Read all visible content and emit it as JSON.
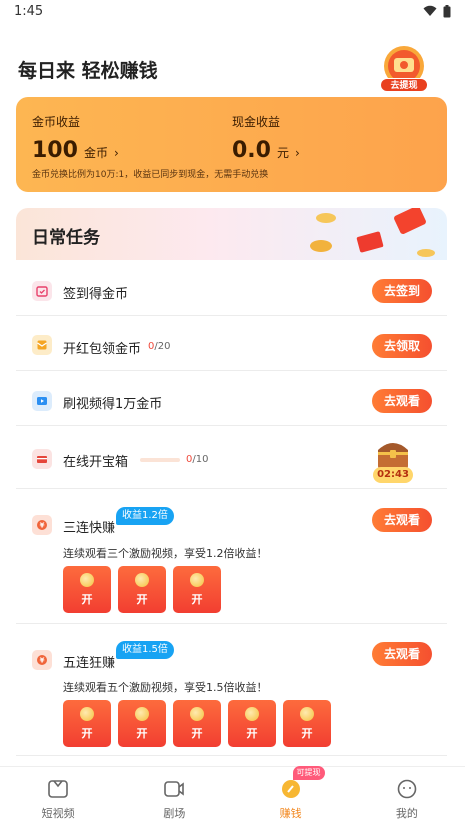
{
  "status_bar": {
    "time": "1:45"
  },
  "header": {
    "title": "每日来 轻松赚钱",
    "rank_label": "去提现"
  },
  "earnings": {
    "coin_title": "金币收益",
    "coin_value": "100",
    "coin_unit": "金币",
    "cash_title": "现金收益",
    "cash_value": "0.0",
    "cash_unit": "元",
    "note": "金币兑换比例为10万:1，收益已同步到现金，无需手动兑换"
  },
  "daily": {
    "title": "日常任务",
    "tasks": [
      {
        "name": "签到得金币",
        "button": "去签到"
      },
      {
        "name": "开红包领金币",
        "progress_current": "0",
        "progress_total": "/20",
        "button": "去领取"
      },
      {
        "name": "刷视频得1万金币",
        "button": "去观看"
      },
      {
        "name": "在线开宝箱",
        "progress_current": "0",
        "progress_total": "/10",
        "timer": "02:43"
      },
      {
        "name": "三连快赚",
        "bonus": "收益1.2倍",
        "desc": "连续观看三个激励视频，享受1.2倍收益！",
        "button": "去观看",
        "envelope_label": "开"
      },
      {
        "name": "五连狂赚",
        "bonus": "收益1.5倍",
        "desc": "连续观看五个激励视频，享受1.5倍收益！",
        "button": "去观看",
        "envelope_label": "开"
      }
    ]
  },
  "tabbar": {
    "tabs": [
      {
        "label": "短视频"
      },
      {
        "label": "剧场"
      },
      {
        "label": "赚钱",
        "badge": "可提现"
      },
      {
        "label": "我的"
      }
    ]
  },
  "colors": {
    "accent": "#f5502f",
    "card": "#fdb652",
    "bonus": "#18a3f3",
    "active_tab": "#f2871e"
  }
}
